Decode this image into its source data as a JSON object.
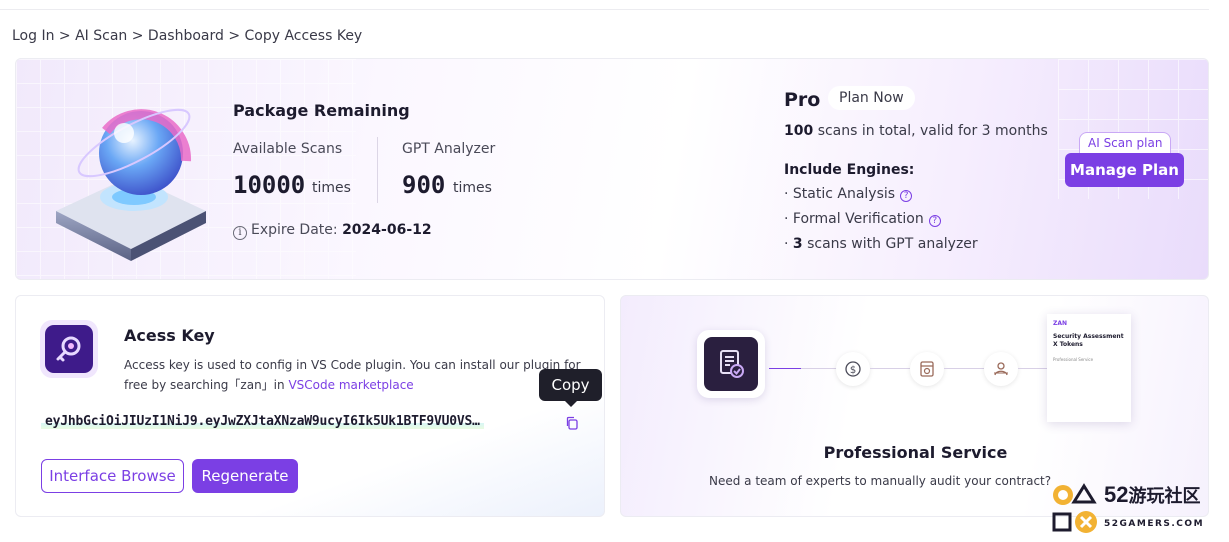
{
  "breadcrumb": "Log In > AI Scan > Dashboard > Copy Access Key",
  "package": {
    "title": "Package Remaining",
    "available_scans_label": "Available Scans",
    "available_scans_value": "10000",
    "available_scans_unit": "times",
    "gpt_label": "GPT Analyzer",
    "gpt_value": "900",
    "gpt_unit": "times",
    "expire_icon": "info-icon",
    "expire_label": "Expire Date:",
    "expire_date": "2024-06-12"
  },
  "plan": {
    "name": "Pro",
    "plan_now": "Plan Now",
    "total_count": "100",
    "total_text": "scans in total, valid for 3 months",
    "engines_title": "Include Engines:",
    "engine_1": "· Static Analysis",
    "engine_2": "· Formal Verification",
    "engine_3_prefix": "·",
    "engine_3_count": "3",
    "engine_3_text": "scans with GPT analyzer",
    "tag": "AI Scan plan",
    "manage_button": "Manage Plan"
  },
  "access_key": {
    "title": "Acess Key",
    "desc_text": "Access key is used to config in VS Code plugin. You can install our plugin for free by searching「zan」in",
    "desc_link": "VSCode marketplace",
    "token": "eyJhbGciOiJIUzI1NiJ9.eyJwZXJtaXNzaW9ucyI6Ik5Uk1BTF9VU0VS…",
    "copy_tooltip": "Copy",
    "interface_browse": "Interface Browse",
    "regenerate": "Regenerate"
  },
  "service": {
    "doc_brand": "ZAN",
    "doc_title": "Security Assessment X Tokens",
    "doc_sub": "Professional Service",
    "title": "Professional Service",
    "desc": "Need a team of experts to manually audit your contract?"
  },
  "watermark": {
    "num": "52",
    "cn": "游玩社区",
    "site": "52GAMERS.COM"
  },
  "colors": {
    "accent": "#7b3fe4",
    "dark": "#1d1b2e"
  }
}
